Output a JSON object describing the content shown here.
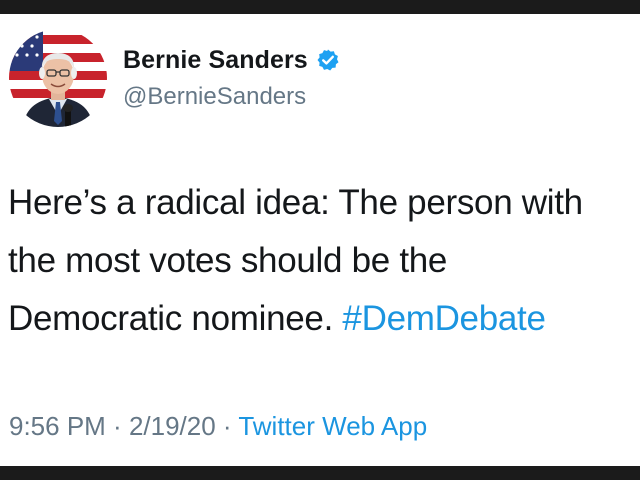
{
  "tweet": {
    "author": {
      "display_name": "Bernie Sanders",
      "handle": "@BernieSanders",
      "verified": true,
      "avatar_icon": "bernie-sanders-portrait-avatar"
    },
    "text_lines": [
      "Here’s a radical idea: The person with",
      "the most votes should be the",
      "Democratic nominee. "
    ],
    "hashtag": "#DemDebate",
    "time": "9:56 PM",
    "separator": " · ",
    "date": "2/19/20",
    "source": "Twitter Web App"
  },
  "colors": {
    "text": "#14171a",
    "secondary": "#657786",
    "link": "#1b95e0",
    "verified_badge": "#1da1f2",
    "frame": "#1b1b1b"
  }
}
